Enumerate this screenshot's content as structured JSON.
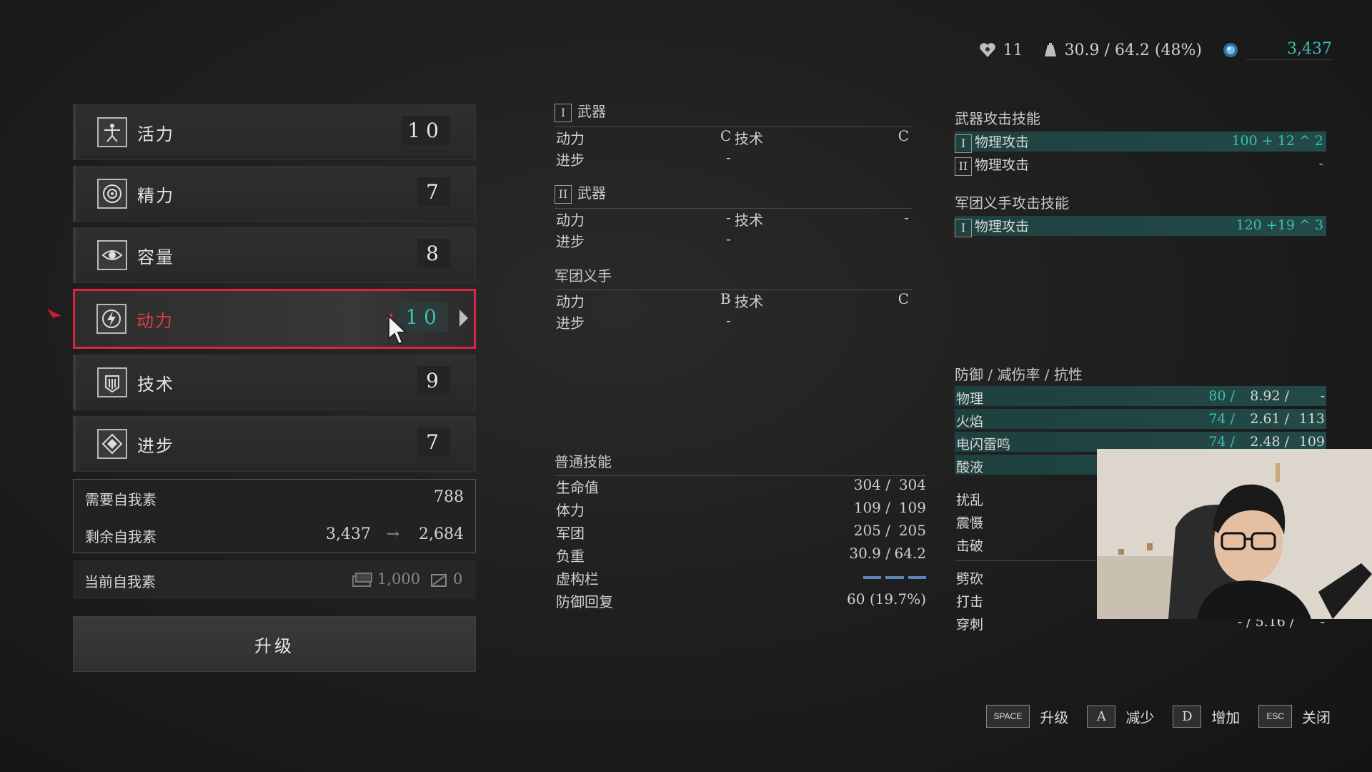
{
  "topbar": {
    "level": "11",
    "weight": "30.9 / 64.2 (48%)",
    "ego": "3,437"
  },
  "attributes": [
    {
      "name": "活力",
      "value": "10",
      "icon": "vitality-figure-icon"
    },
    {
      "name": "精力",
      "value": "7",
      "icon": "energy-target-icon"
    },
    {
      "name": "容量",
      "value": "8",
      "icon": "capacity-eye-icon"
    },
    {
      "name": "动力",
      "value": "10",
      "icon": "motivity-lightning-icon"
    },
    {
      "name": "技术",
      "value": "9",
      "icon": "technique-fist-icon"
    },
    {
      "name": "进步",
      "value": "7",
      "icon": "advance-diamond-icon"
    }
  ],
  "cost": {
    "required_label": "需要自我素",
    "required_value": "788",
    "remaining_label": "剩余自我素",
    "remaining_from": "3,437",
    "remaining_to": "2,684"
  },
  "current": {
    "label": "当前自我素",
    "ergo_value": "1,000",
    "item_value": "0"
  },
  "upgrade_label": "升级",
  "weapon1": {
    "roman": "I",
    "title": "武器",
    "rows": [
      {
        "label": "动力",
        "grade": "C",
        "tech_label": "技术",
        "tech_grade": "C"
      },
      {
        "label": "进步",
        "grade": "-"
      }
    ]
  },
  "weapon2": {
    "roman": "II",
    "title": "武器",
    "rows": [
      {
        "label": "动力",
        "grade": "-",
        "tech_label": "技术",
        "tech_grade": "-"
      },
      {
        "label": "进步",
        "grade": "-"
      }
    ]
  },
  "legion": {
    "title": "军团义手",
    "rows": [
      {
        "label": "动力",
        "grade": "B",
        "tech_label": "技术",
        "tech_grade": "C"
      },
      {
        "label": "进步",
        "grade": "-"
      }
    ]
  },
  "general": {
    "title": "普通技能",
    "rows": [
      {
        "label": "生命值",
        "a": "304 /",
        "b": "304"
      },
      {
        "label": "体力",
        "a": "109 /",
        "b": "109"
      },
      {
        "label": "军团",
        "a": "205 /",
        "b": "205"
      },
      {
        "label": "负重",
        "a": "30.9 /",
        "b": "64.2"
      },
      {
        "label": "虚构栏",
        "a": "",
        "b": ""
      },
      {
        "label": "防御回复",
        "a": "",
        "b": "60 (19.7%)"
      }
    ]
  },
  "weapon_attack": {
    "title": "武器攻击技能",
    "rows": [
      {
        "roman": "I",
        "label": "物理攻击",
        "value": "100 + 12 ^ 2"
      },
      {
        "roman": "II",
        "label": "物理攻击",
        "value": "-"
      }
    ]
  },
  "legion_attack": {
    "title": "军团义手攻击技能",
    "rows": [
      {
        "roman": "I",
        "label": "物理攻击",
        "value": "120 +19 ^ 3"
      }
    ]
  },
  "defense": {
    "title": "防御 / 减伤率 / 抗性",
    "rows": [
      {
        "label": "物理",
        "a": "80 /",
        "b": "8.92 /",
        "c": "-"
      },
      {
        "label": "火焰",
        "a": "74 /",
        "b": "2.61 /",
        "c": "113"
      },
      {
        "label": "电闪雷鸣",
        "a": "74 /",
        "b": "2.48 /",
        "c": "109"
      },
      {
        "label": "酸液",
        "a": "",
        "b": "",
        "c": ""
      }
    ],
    "resist_rows": [
      {
        "label": "扰乱"
      },
      {
        "label": "震慑"
      },
      {
        "label": "击破"
      }
    ],
    "phys_rows": [
      {
        "label": "劈砍",
        "v": ""
      },
      {
        "label": "打击",
        "v": ""
      },
      {
        "label": "穿刺",
        "v": "- / 5.16 /      -"
      }
    ]
  },
  "hotkeys": [
    {
      "key": "SPACE",
      "label": "升级"
    },
    {
      "key": "A",
      "label": "减少"
    },
    {
      "key": "D",
      "label": "增加"
    },
    {
      "key": "ESC",
      "label": "关闭"
    }
  ],
  "colors": {
    "accent": "#3fbfb3",
    "selected": "#d7263d"
  }
}
